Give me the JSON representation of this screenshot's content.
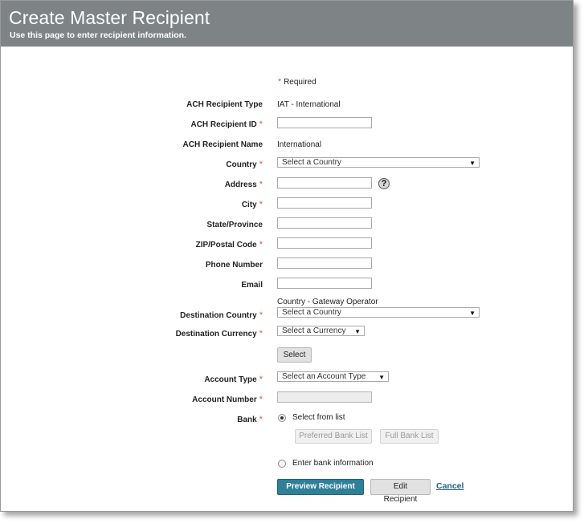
{
  "header": {
    "title": "Create Master Recipient",
    "subtitle": "Use this page to enter recipient information."
  },
  "required_note": {
    "star": "*",
    "text": "Required"
  },
  "fields": {
    "ach_recipient_type": {
      "label": "ACH Recipient Type",
      "value": "IAT - International"
    },
    "ach_recipient_id": {
      "label": "ACH Recipient ID",
      "value": ""
    },
    "ach_recipient_name": {
      "label": "ACH Recipient Name",
      "value": "International"
    },
    "country": {
      "label": "Country",
      "selected": "Select a Country"
    },
    "address": {
      "label": "Address",
      "value": ""
    },
    "city": {
      "label": "City",
      "value": ""
    },
    "state_province": {
      "label": "State/Province",
      "value": ""
    },
    "zip": {
      "label": "ZIP/Postal Code",
      "value": ""
    },
    "phone": {
      "label": "Phone Number",
      "value": ""
    },
    "email": {
      "label": "Email",
      "value": ""
    },
    "destination_country": {
      "label": "Destination Country",
      "hint": "Country - Gateway Operator",
      "selected": "Select a Country"
    },
    "destination_currency": {
      "label": "Destination Currency",
      "selected": "Select a Currency"
    },
    "account_type": {
      "label": "Account Type",
      "selected": "Select an Account Type"
    },
    "account_number": {
      "label": "Account Number",
      "value": ""
    },
    "bank": {
      "label": "Bank",
      "option_list": "Select from list",
      "option_enter": "Enter bank information",
      "preferred_bank_list": "Preferred Bank List",
      "full_bank_list": "Full Bank List"
    }
  },
  "buttons": {
    "select": "Select",
    "preview": "Preview Recipient",
    "edit": "Edit Recipient",
    "cancel": "Cancel"
  },
  "symbols": {
    "required": "*",
    "help": "?",
    "dropdown_arrow": "▼"
  },
  "colors": {
    "header_bg": "#7e8386",
    "primary_button": "#2f7f98",
    "required_star": "#d9534f",
    "link": "#1f5f8b"
  }
}
